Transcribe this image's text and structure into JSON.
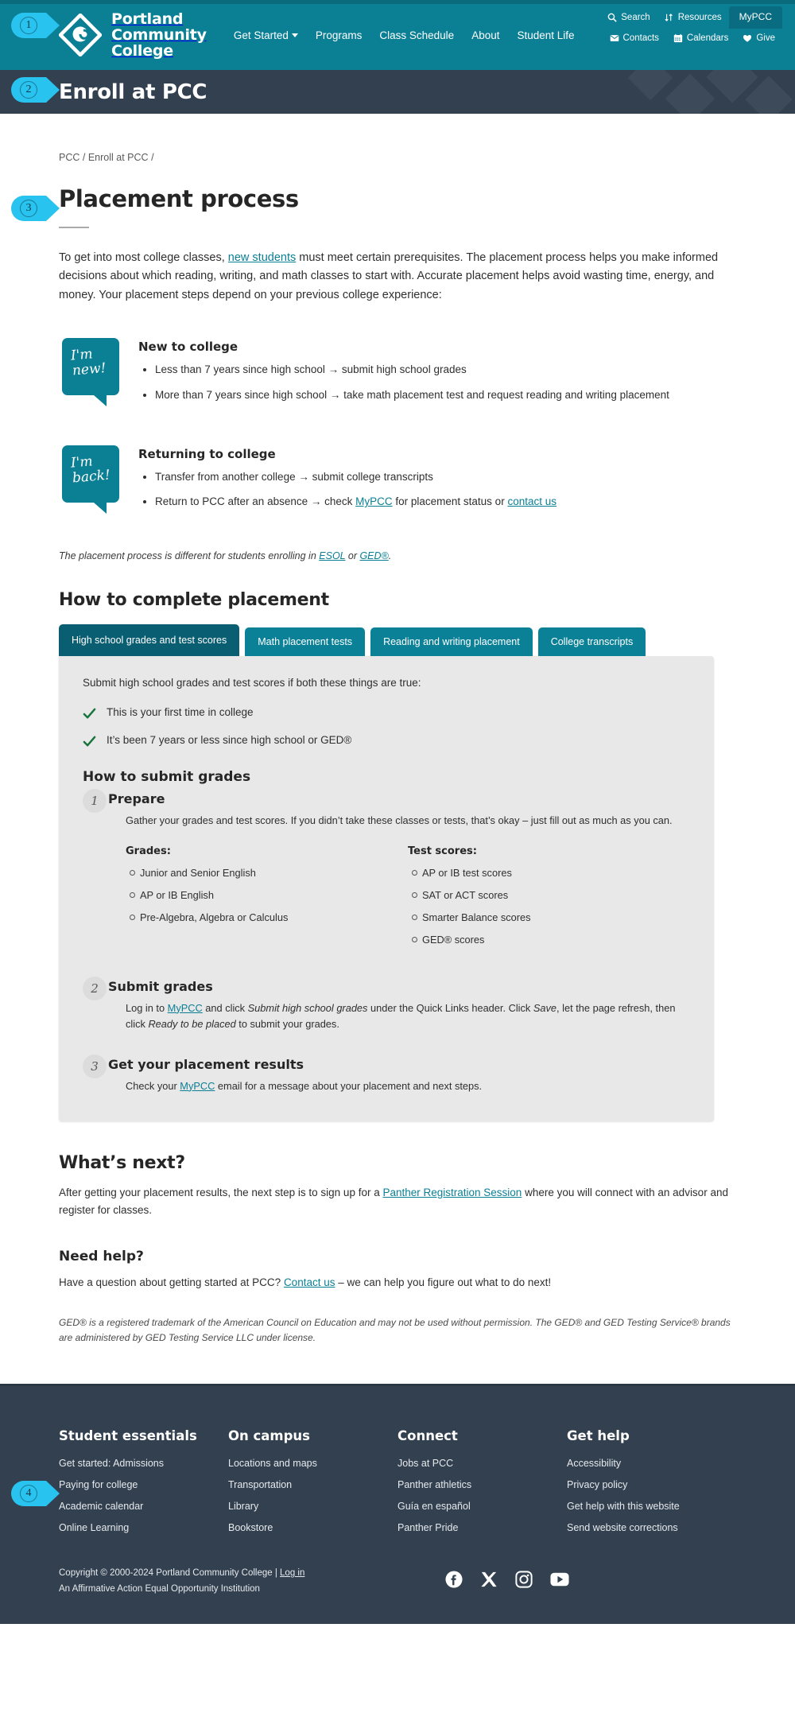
{
  "brand": {
    "name_line1": "Portland",
    "name_line2": "Community",
    "name_line3": "College",
    "logo_icon": "pcc-diamond-logo",
    "primary_color": "#0b7f94",
    "accent_color": "#29c3ef",
    "dark_color": "#33404f"
  },
  "callouts": [
    {
      "label": "1"
    },
    {
      "label": "2"
    },
    {
      "label": "3"
    },
    {
      "label": "4"
    }
  ],
  "header": {
    "nav": [
      {
        "label": "Get Started",
        "has_dropdown": true,
        "icon": "chevron-down-icon"
      },
      {
        "label": "Programs",
        "has_dropdown": false
      },
      {
        "label": "Class Schedule",
        "has_dropdown": false
      },
      {
        "label": "About",
        "has_dropdown": false
      },
      {
        "label": "Student Life",
        "has_dropdown": false
      }
    ],
    "util_row_1": [
      {
        "label": "Search",
        "icon": "search-icon"
      },
      {
        "label": "Resources",
        "icon": "sort-arrows-icon"
      },
      {
        "label": "MyPCC",
        "icon": null,
        "highlighted": true
      }
    ],
    "util_row_2": [
      {
        "label": "Contacts",
        "icon": "envelope-icon"
      },
      {
        "label": "Calendars",
        "icon": "calendar-icon"
      },
      {
        "label": "Give",
        "icon": "heart-icon"
      }
    ]
  },
  "banner": {
    "title": "Enroll at PCC"
  },
  "breadcrumb": {
    "text": "PCC / Enroll at PCC /",
    "items": [
      "PCC",
      "Enroll at PCC"
    ]
  },
  "main": {
    "title": "Placement process",
    "intro_part1": "To get into most college classes, ",
    "intro_link": "new students",
    "intro_part2": " must meet certain prerequisites. The placement process helps you make informed decisions about which reading, writing, and math classes to start with. Accurate placement helps avoid wasting time, energy, and money. Your placement steps depend on your previous college experience:",
    "cards": [
      {
        "bubble_line1": "I'm",
        "bubble_line2": "new!",
        "heading": "New to college",
        "items": [
          "Less than 7 years since high school  →  submit high school grades",
          "More than 7 years since high school  →  take math placement test and request reading and writing placement"
        ]
      },
      {
        "bubble_line1": "I'm",
        "bubble_line2": "back!",
        "heading": "Returning to college",
        "items": [
          "Transfer from another college  →  submit college transcripts",
          "Return to PCC after an absence  →  check MyPCC for placement status or contact us"
        ],
        "item2_pre": "Return to PCC after an absence  →  check ",
        "item2_link1": "MyPCC",
        "item2_mid": " for placement status or ",
        "item2_link2": "contact us"
      }
    ],
    "note_pre": "The placement process is different for students enrolling in ",
    "note_link1": "ESOL",
    "note_mid": " or ",
    "note_link2": "GED®",
    "note_post": ".",
    "section_title": "How to complete placement",
    "tabs": [
      {
        "label": "High school grades and test scores",
        "active": true
      },
      {
        "label": "Math placement tests",
        "active": false
      },
      {
        "label": "Reading and writing placement",
        "active": false
      },
      {
        "label": "College transcripts",
        "active": false
      }
    ],
    "panel": {
      "lead": "Submit high school grades and test scores if both these things are true:",
      "checks": [
        {
          "icon": "check-icon",
          "text": "This is your first time in college"
        },
        {
          "icon": "check-icon",
          "text": "It’s been 7 years or less since high school or GED®"
        }
      ],
      "how_title": "How to submit grades",
      "steps": [
        {
          "num": "1",
          "title": "Prepare",
          "body": "Gather your grades and test scores. If you didn’t take these classes or tests, that’s okay – just fill out as much as you can.",
          "columns": [
            {
              "heading": "Grades:",
              "items": [
                "Junior and Senior English",
                "AP or IB English",
                "Pre-Algebra, Algebra or Calculus"
              ]
            },
            {
              "heading": "Test scores:",
              "items": [
                "AP or IB test scores",
                "SAT or ACT scores",
                "Smarter Balance scores",
                "GED® scores"
              ]
            }
          ]
        },
        {
          "num": "2",
          "title": "Submit grades",
          "body_pre": "Log in to ",
          "body_link": "MyPCC",
          "body_mid1": " and click ",
          "body_em1": "Submit high school grades",
          "body_mid2": " under the Quick Links header. Click ",
          "body_em2": "Save",
          "body_mid3": ", let the page refresh, then click ",
          "body_em3": "Ready to be placed",
          "body_post": " to submit your grades."
        },
        {
          "num": "3",
          "title": "Get your placement results",
          "body_pre": "Check your ",
          "body_link": "MyPCC",
          "body_post": " email for a message about your placement and next steps."
        }
      ]
    },
    "whats_next_title": "What’s next?",
    "whats_next_pre": "After getting your placement results, the next step is to sign up for a ",
    "whats_next_link": "Panther Registration Session",
    "whats_next_post": " where you will connect with an advisor and register for classes.",
    "need_help_title": "Need help?",
    "need_help_pre": "Have a question about getting started at PCC? ",
    "need_help_link": "Contact us",
    "need_help_post": " – we can help you figure out what to do next!",
    "disclaimer": "GED® is a registered trademark of the American Council on Education and may not be used without permission. The GED® and GED Testing Service® brands are administered by GED Testing Service LLC under license."
  },
  "footer": {
    "columns": [
      {
        "heading": "Student essentials",
        "links": [
          "Get started: Admissions",
          "Paying for college",
          "Academic calendar",
          "Online Learning"
        ]
      },
      {
        "heading": "On campus",
        "links": [
          "Locations and maps",
          "Transportation",
          "Library",
          "Bookstore"
        ]
      },
      {
        "heading": "Connect",
        "links": [
          "Jobs at PCC",
          "Panther athletics",
          "Guía en español",
          "Panther Pride"
        ]
      },
      {
        "heading": "Get help",
        "links": [
          "Accessibility",
          "Privacy policy",
          "Get help with this website",
          "Send website corrections"
        ]
      }
    ],
    "copyright_pre": "Copyright © 2000-2024 Portland Community College | ",
    "copyright_link": "Log in",
    "affirmative": "An Affirmative Action Equal Opportunity Institution",
    "social": [
      {
        "name": "facebook-icon",
        "label": "Facebook"
      },
      {
        "name": "x-twitter-icon",
        "label": "X"
      },
      {
        "name": "instagram-icon",
        "label": "Instagram"
      },
      {
        "name": "youtube-icon",
        "label": "YouTube"
      }
    ]
  }
}
